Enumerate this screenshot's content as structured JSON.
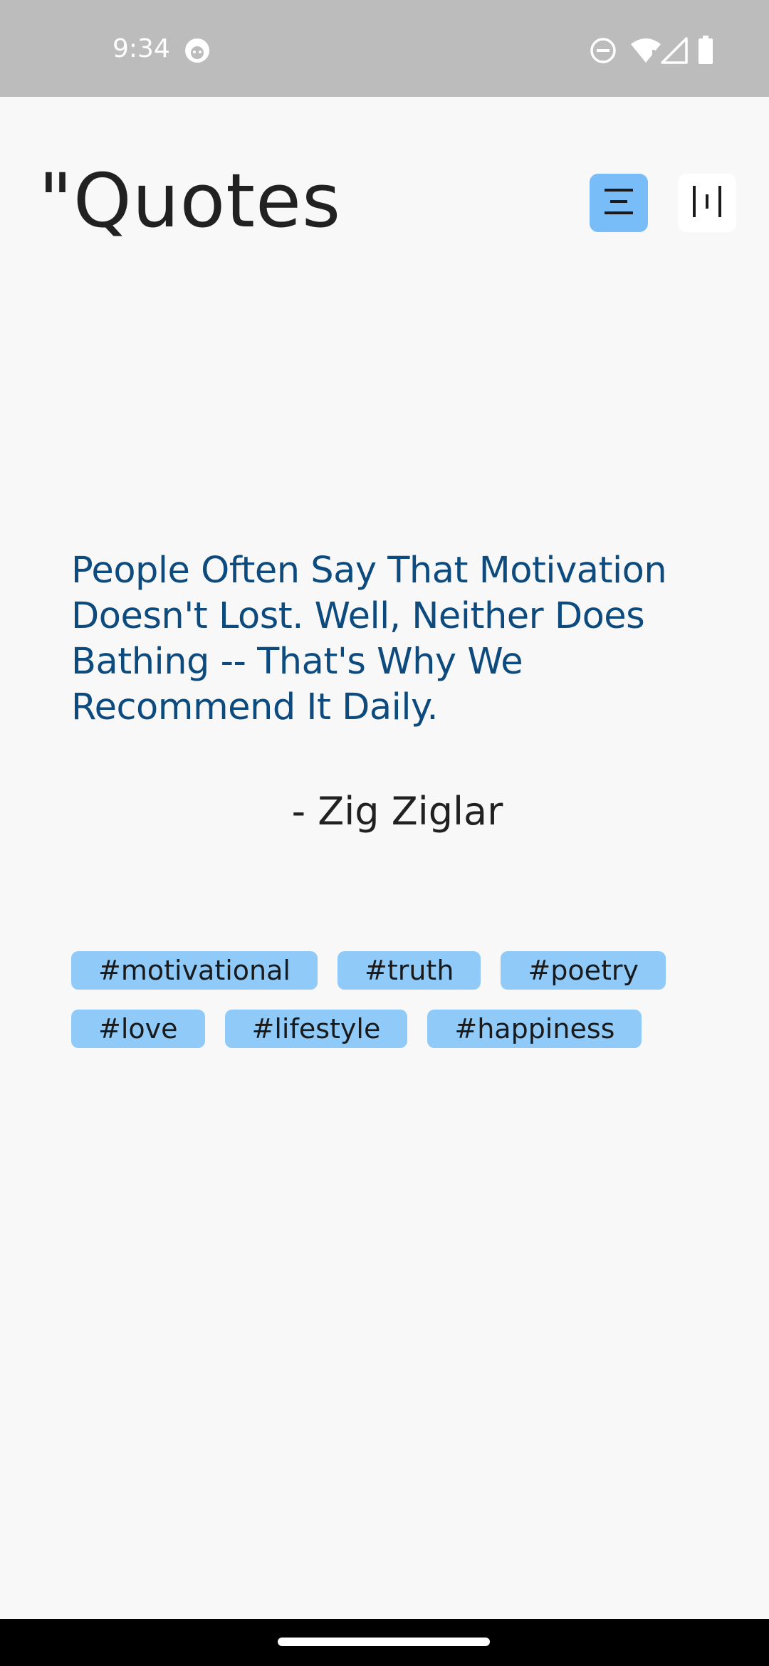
{
  "status_bar": {
    "time": "9:34",
    "icons": [
      "face-notification-icon",
      "do-not-disturb-icon",
      "wifi-icon",
      "signal-icon",
      "battery-icon"
    ],
    "background": "#bcbcbc"
  },
  "header": {
    "title": "\"Quotes",
    "buttons": [
      {
        "name": "list-layout",
        "icon": "center-align-icon",
        "active": true
      },
      {
        "name": "columns-layout",
        "icon": "columns-icon",
        "active": false
      }
    ]
  },
  "quote": {
    "text": "People Often Say That Motivation Doesn't Lost. Well, Neither Does Bathing -- That's Why We Recommend It Daily.",
    "author": "- Zig Ziglar",
    "color": "#0d4a7e"
  },
  "tags": {
    "row1": [
      "#motivational",
      "#truth",
      "#poetry"
    ],
    "row2": [
      "#love",
      "#lifestyle",
      "#happiness"
    ],
    "color": "#90caf9"
  },
  "colors": {
    "accent": "#78bdf8",
    "background": "#f8f8f8"
  }
}
